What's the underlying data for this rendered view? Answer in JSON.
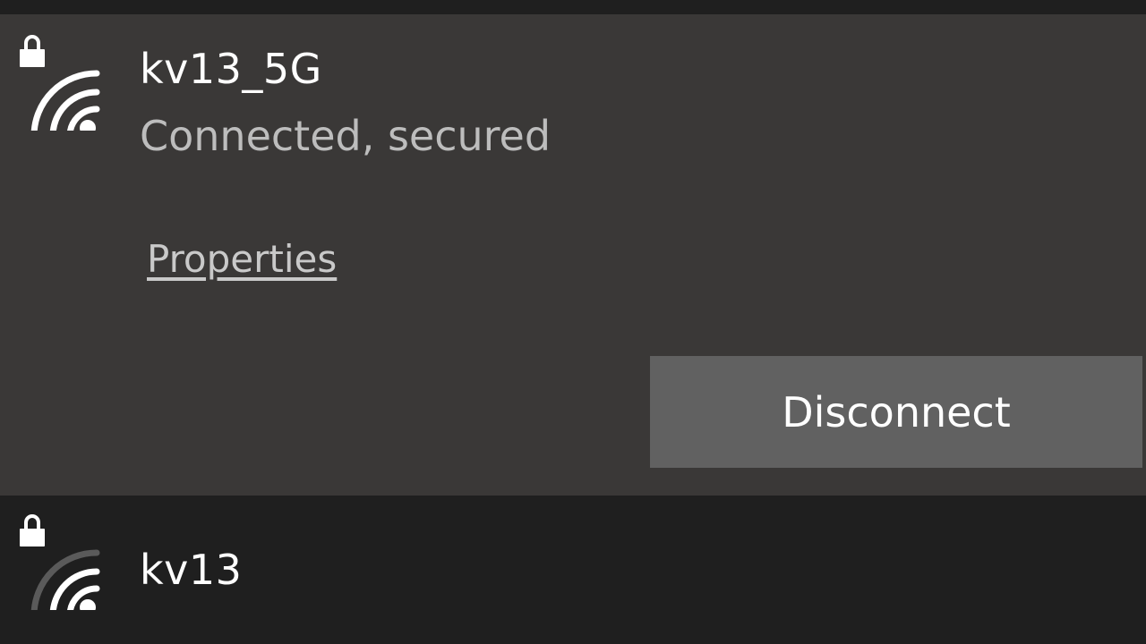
{
  "networks": [
    {
      "ssid": "kv13_5G",
      "status": "Connected, secured",
      "properties_label": "Properties",
      "disconnect_label": "Disconnect",
      "icon": "wifi-secured-icon"
    },
    {
      "ssid": "kv13",
      "icon": "wifi-secured-icon"
    }
  ],
  "colors": {
    "panel_bg": "#1f1f1f",
    "expanded_bg": "#3a3837",
    "button_bg": "#616161",
    "text_primary": "#ffffff",
    "text_secondary": "#bdbdbd"
  }
}
